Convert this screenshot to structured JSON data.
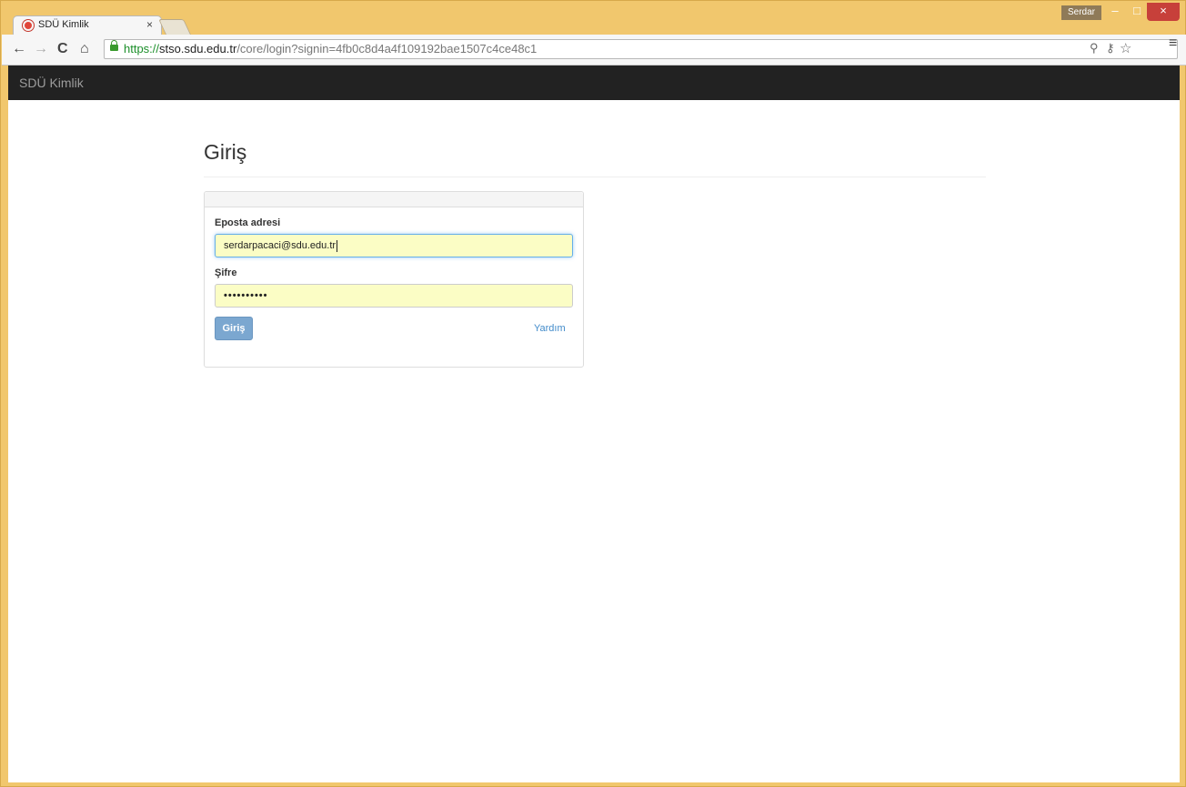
{
  "browser": {
    "tab_title": "SDÜ Kimlik",
    "tab_close": "×",
    "user_name": "Serdar",
    "window_controls": {
      "minimize": "–",
      "maximize": "□",
      "close": "×"
    },
    "nav": {
      "back": "←",
      "forward": "→",
      "reload": "C",
      "home": "⌂"
    },
    "url": {
      "scheme": "https://",
      "host": "stso.sdu.edu.tr",
      "path": "/core/login?signin=4fb0c8d4a4f109192bae1507c4ce48c1"
    },
    "omnibox_icons": {
      "zoom": "⚲",
      "key": "⚷",
      "star": "☆"
    },
    "menu": "≡"
  },
  "page": {
    "brand": "SDÜ Kimlik",
    "title": "Giriş",
    "form": {
      "email_label": "Eposta adresi",
      "email_value": "serdarpacaci@sdu.edu.tr",
      "password_label": "Şifre",
      "password_value": "••••••••••",
      "submit_label": "Giriş",
      "help_link": "Yardım"
    }
  },
  "colors": {
    "window_frame": "#f1c76d",
    "navbar": "#222222",
    "brand_text": "#9d9d9d",
    "button": "#7ba7d0",
    "link": "#428bca",
    "autofill_bg": "#fbfdc5",
    "secure_green": "#1c8f2a"
  }
}
